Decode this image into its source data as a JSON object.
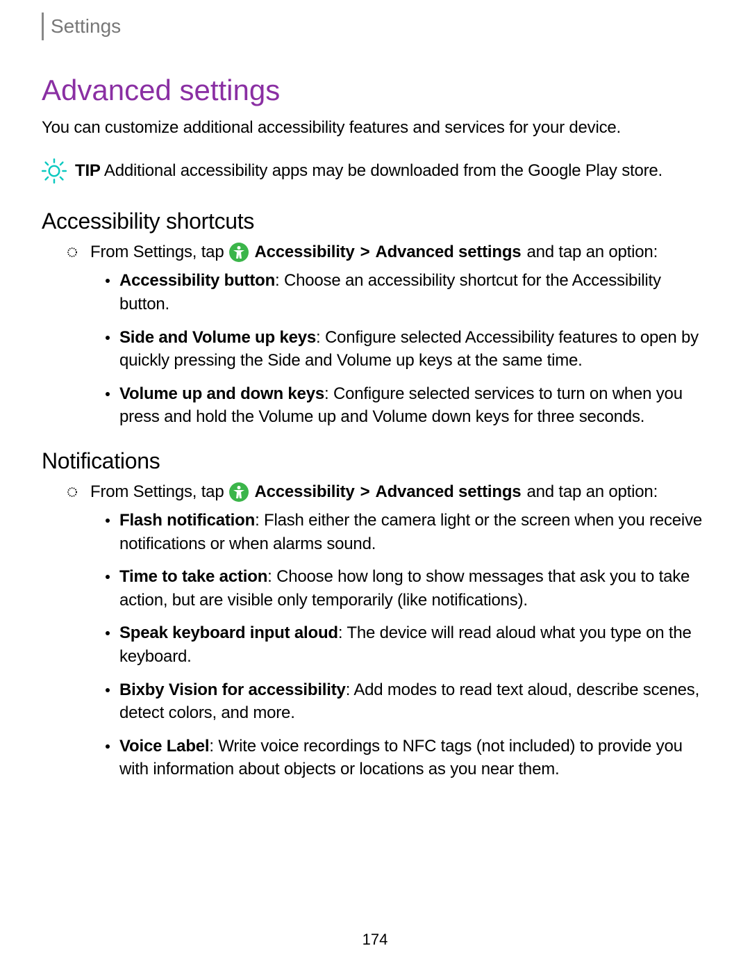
{
  "header": {
    "breadcrumb": "Settings"
  },
  "title": "Advanced settings",
  "intro": "You can customize additional accessibility features and services for your device.",
  "tip": {
    "label": "TIP",
    "text": "Additional accessibility apps may be downloaded from the Google Play store."
  },
  "sections": [
    {
      "heading": "Accessibility shortcuts",
      "step_prefix": "From Settings, tap",
      "step_path_1": "Accessibility",
      "step_sep": ">",
      "step_path_2": "Advanced settings",
      "step_suffix": "and tap an option:",
      "items": [
        {
          "bold": "Accessibility button",
          "text": ": Choose an accessibility shortcut for the Accessibility button."
        },
        {
          "bold": "Side and Volume up keys",
          "text": ": Configure selected Accessibility features to open by quickly pressing the Side and Volume up keys at the same time."
        },
        {
          "bold": "Volume up and down keys",
          "text": ": Configure selected services to turn on when you press and hold the Volume up and Volume down keys for three seconds."
        }
      ]
    },
    {
      "heading": "Notifications",
      "step_prefix": "From Settings, tap",
      "step_path_1": "Accessibility",
      "step_sep": ">",
      "step_path_2": "Advanced settings",
      "step_suffix": "and tap an option:",
      "items": [
        {
          "bold": "Flash notification",
          "text": ": Flash either the camera light or the screen when you receive notifications or when alarms sound."
        },
        {
          "bold": "Time to take action",
          "text": ": Choose how long to show messages that ask you to take action, but are visible only temporarily (like notifications)."
        },
        {
          "bold": "Speak keyboard input aloud",
          "text": ": The device will read aloud what you type on the keyboard."
        },
        {
          "bold": "Bixby Vision for accessibility",
          "text": ": Add modes to read text aloud, describe scenes, detect colors, and more."
        },
        {
          "bold": "Voice Label",
          "text": ": Write voice recordings to NFC tags (not included) to provide you with information about objects or locations as you near them."
        }
      ]
    }
  ],
  "page_number": "174"
}
